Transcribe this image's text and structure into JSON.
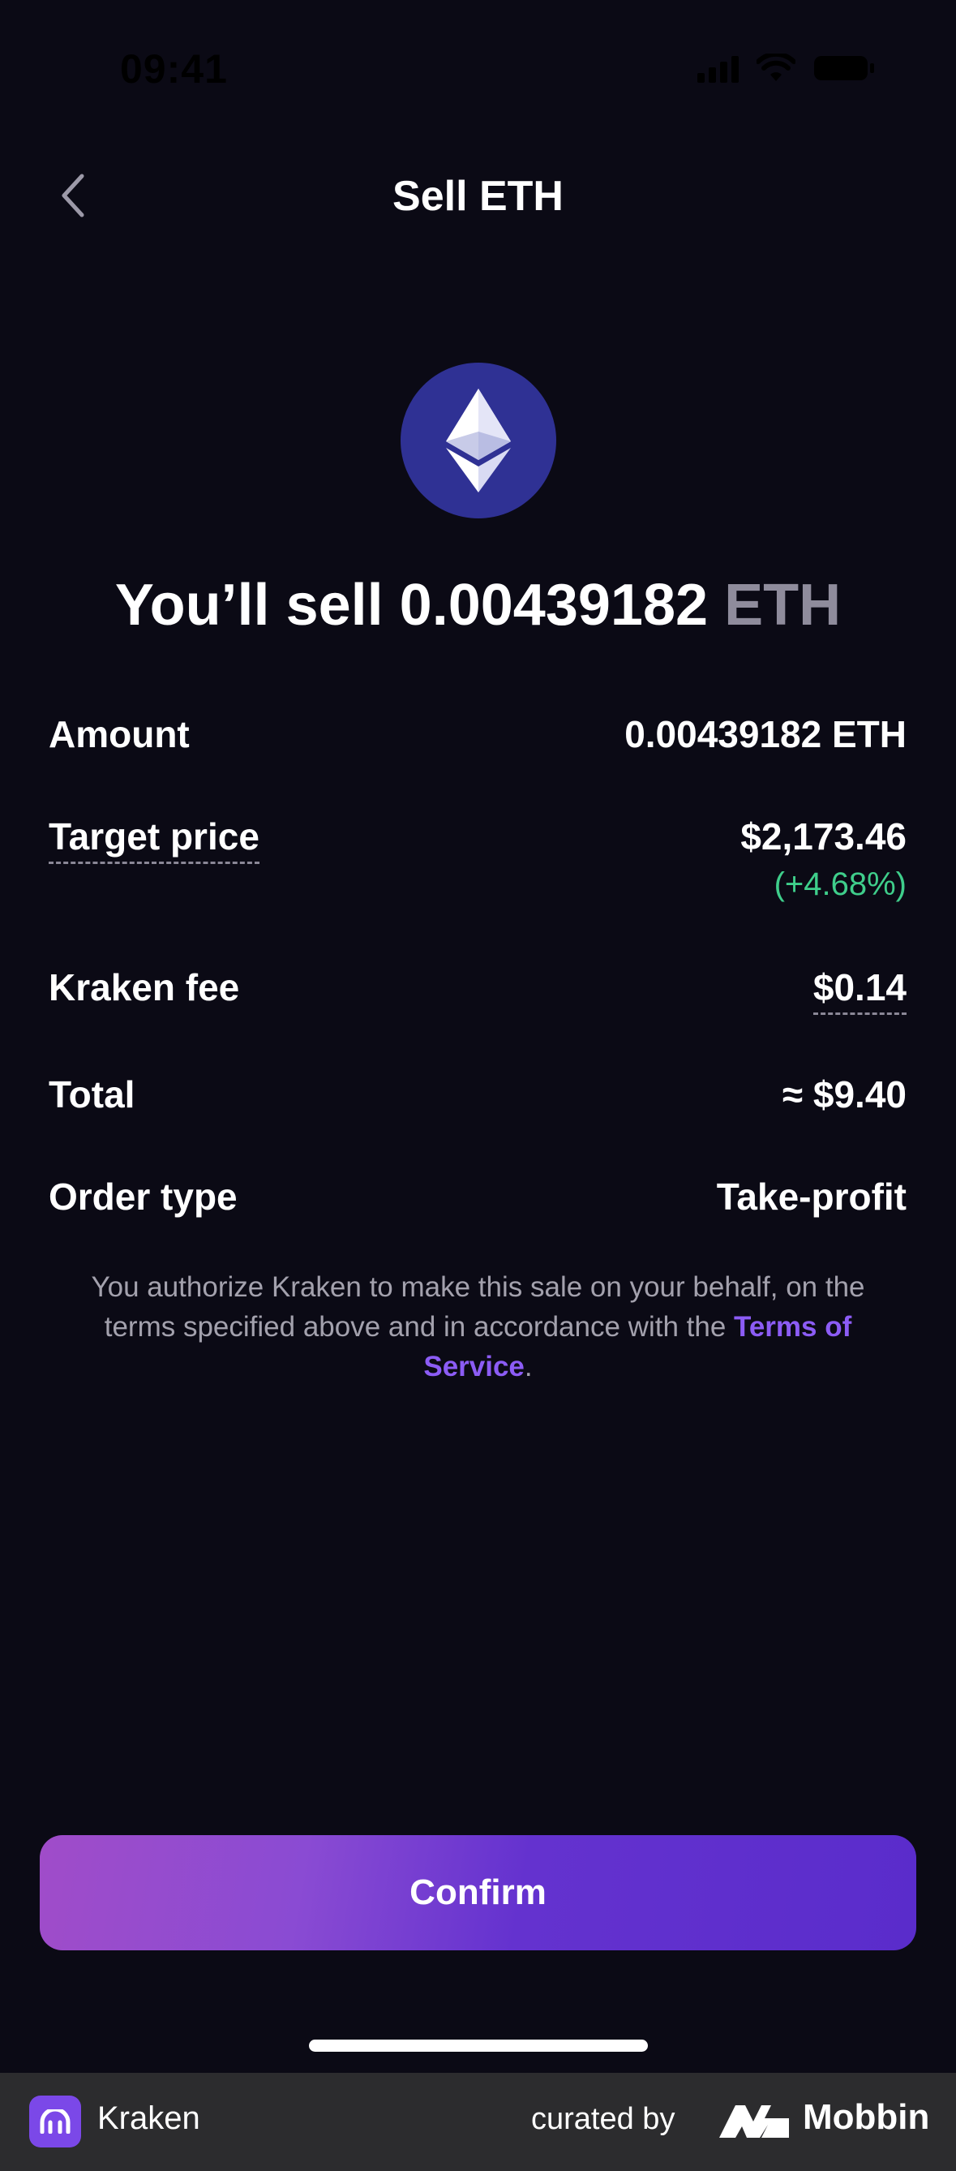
{
  "status_bar": {
    "time": "09:41"
  },
  "nav": {
    "title": "Sell ETH",
    "back_icon": "chevron-left-icon"
  },
  "asset": {
    "icon": "ethereum-icon",
    "icon_color": "#2f3194"
  },
  "headline": {
    "prefix": "You’ll sell 0.00439182",
    "unit": "ETH"
  },
  "details": {
    "amount": {
      "label": "Amount",
      "value": "0.00439182 ETH"
    },
    "target_price": {
      "label": "Target price",
      "value": "$2,173.46",
      "change": "(+4.68%)"
    },
    "fee": {
      "label": "Kraken fee",
      "value": "$0.14"
    },
    "total": {
      "label": "Total",
      "value": "≈ $9.40"
    },
    "order_type": {
      "label": "Order type",
      "value": "Take-profit"
    }
  },
  "disclaimer": {
    "text": "You authorize Kraken to make this sale on your behalf, on the terms specified above and in accordance with the",
    "link": "Terms of Service",
    "end": "."
  },
  "confirm": {
    "label": "Confirm"
  },
  "footer": {
    "app_name": "Kraken",
    "curated_by": "curated by",
    "brand": "Mobbin"
  },
  "colors": {
    "background": "#0b0a15",
    "positive": "#3fce8b",
    "link": "#8c5cf5",
    "accent_start": "#a04cc9",
    "accent_end": "#5a2ccb"
  }
}
